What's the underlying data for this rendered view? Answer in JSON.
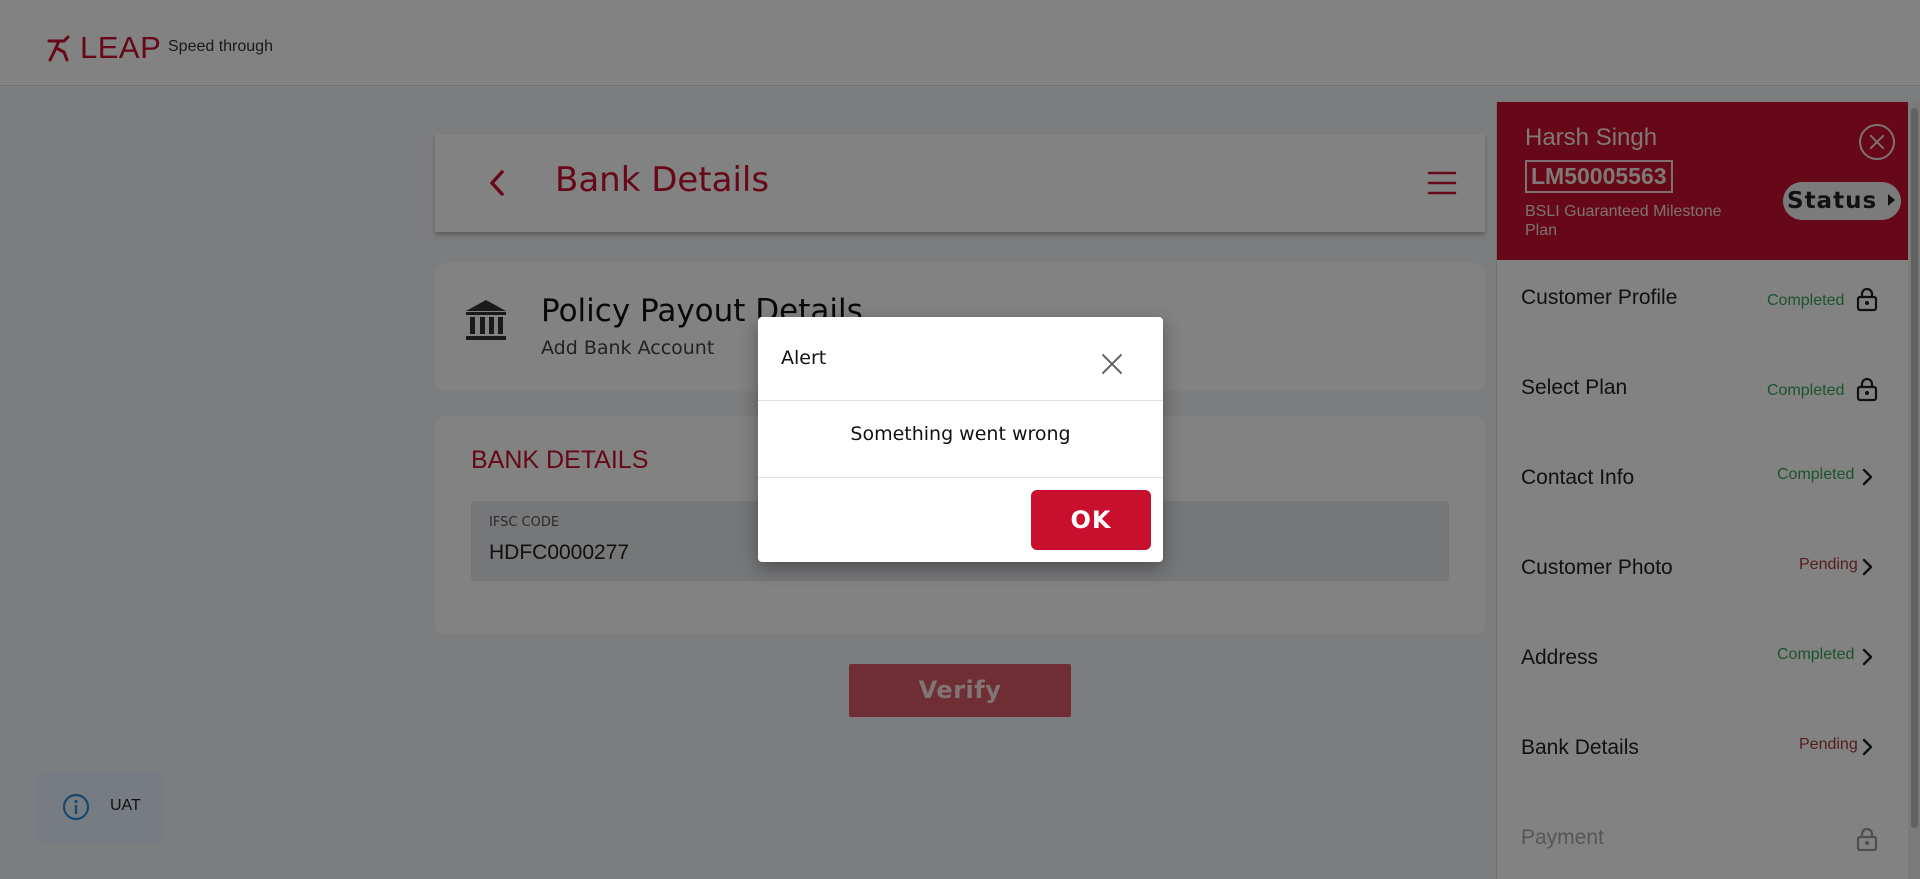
{
  "topbar": {
    "logo_text": "LEAP",
    "tagline": "Speed through"
  },
  "header": {
    "title": "Bank Details"
  },
  "policy": {
    "title": "Policy Payout Details",
    "subtitle": "Add Bank Account"
  },
  "bank": {
    "heading": "BANK DETAILS",
    "ifsc_label": "IFSC CODE",
    "ifsc_value": "HDFC0000277",
    "verify_label": "Verify"
  },
  "customer": {
    "name": "Harsh Singh",
    "id": "LM50005563",
    "plan": "BSLI Guaranteed Milestone Plan",
    "status_label": "Status"
  },
  "steps": [
    {
      "label": "Customer Profile",
      "status": "Completed",
      "icon": "lock-icon"
    },
    {
      "label": "Select Plan",
      "status": "Completed",
      "icon": "lock-icon"
    },
    {
      "label": "Contact Info",
      "status": "Completed",
      "icon": "chevron-right-icon"
    },
    {
      "label": "Customer Photo",
      "status": "Pending",
      "icon": "chevron-right-icon"
    },
    {
      "label": "Address",
      "status": "Completed",
      "icon": "chevron-right-icon"
    },
    {
      "label": "Bank Details",
      "status": "Pending",
      "icon": "chevron-right-icon"
    },
    {
      "label": "Payment",
      "status": "",
      "icon": "lock-icon"
    }
  ],
  "env_badge": {
    "label": "UAT"
  },
  "alert": {
    "title": "Alert",
    "message": "Something went wrong",
    "ok_label": "OK"
  },
  "colors": {
    "brand": "#c8102e",
    "completed": "#3aa35c",
    "pending": "#a83a3a"
  }
}
